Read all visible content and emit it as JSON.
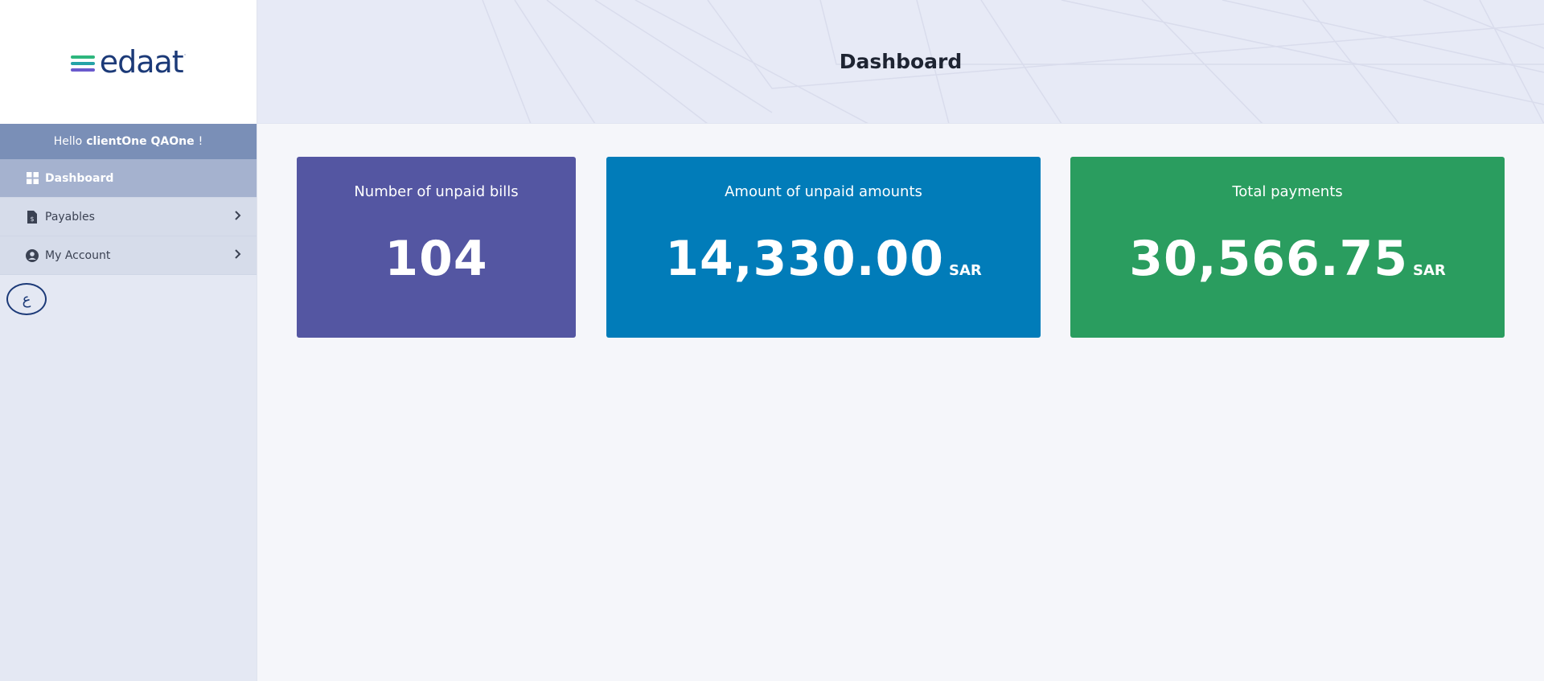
{
  "sidebar": {
    "logo_text": "edaat",
    "logo_mark": "·",
    "greeting": {
      "prefix": "Hello",
      "name": "clientOne QAOne",
      "suffix": "!"
    },
    "items": [
      {
        "label": "Dashboard",
        "icon": "dashboard-grid-icon",
        "active": true
      },
      {
        "label": "Payables",
        "icon": "invoice-icon",
        "expandable": true
      },
      {
        "label": "My Account",
        "icon": "user-circle-icon",
        "expandable": true
      }
    ],
    "language_toggle": "ع"
  },
  "header": {
    "title": "Dashboard"
  },
  "cards": [
    {
      "title": "Number of unpaid bills",
      "value": "104",
      "unit": "",
      "color": "#5456a2"
    },
    {
      "title": "Amount of unpaid amounts",
      "value": "14,330.00",
      "unit": "SAR",
      "color": "#017cb9"
    },
    {
      "title": "Total payments",
      "value": "30,566.75",
      "unit": "SAR",
      "color": "#2a9d5f"
    }
  ],
  "colors": {
    "brand_navy": "#1c3a78",
    "logo_green": "#2eb67d",
    "logo_teal": "#25a3a8",
    "logo_purple": "#6a5acd",
    "greeting_bg": "#7a8fb7",
    "active_nav_bg": "#a5b2cf"
  }
}
